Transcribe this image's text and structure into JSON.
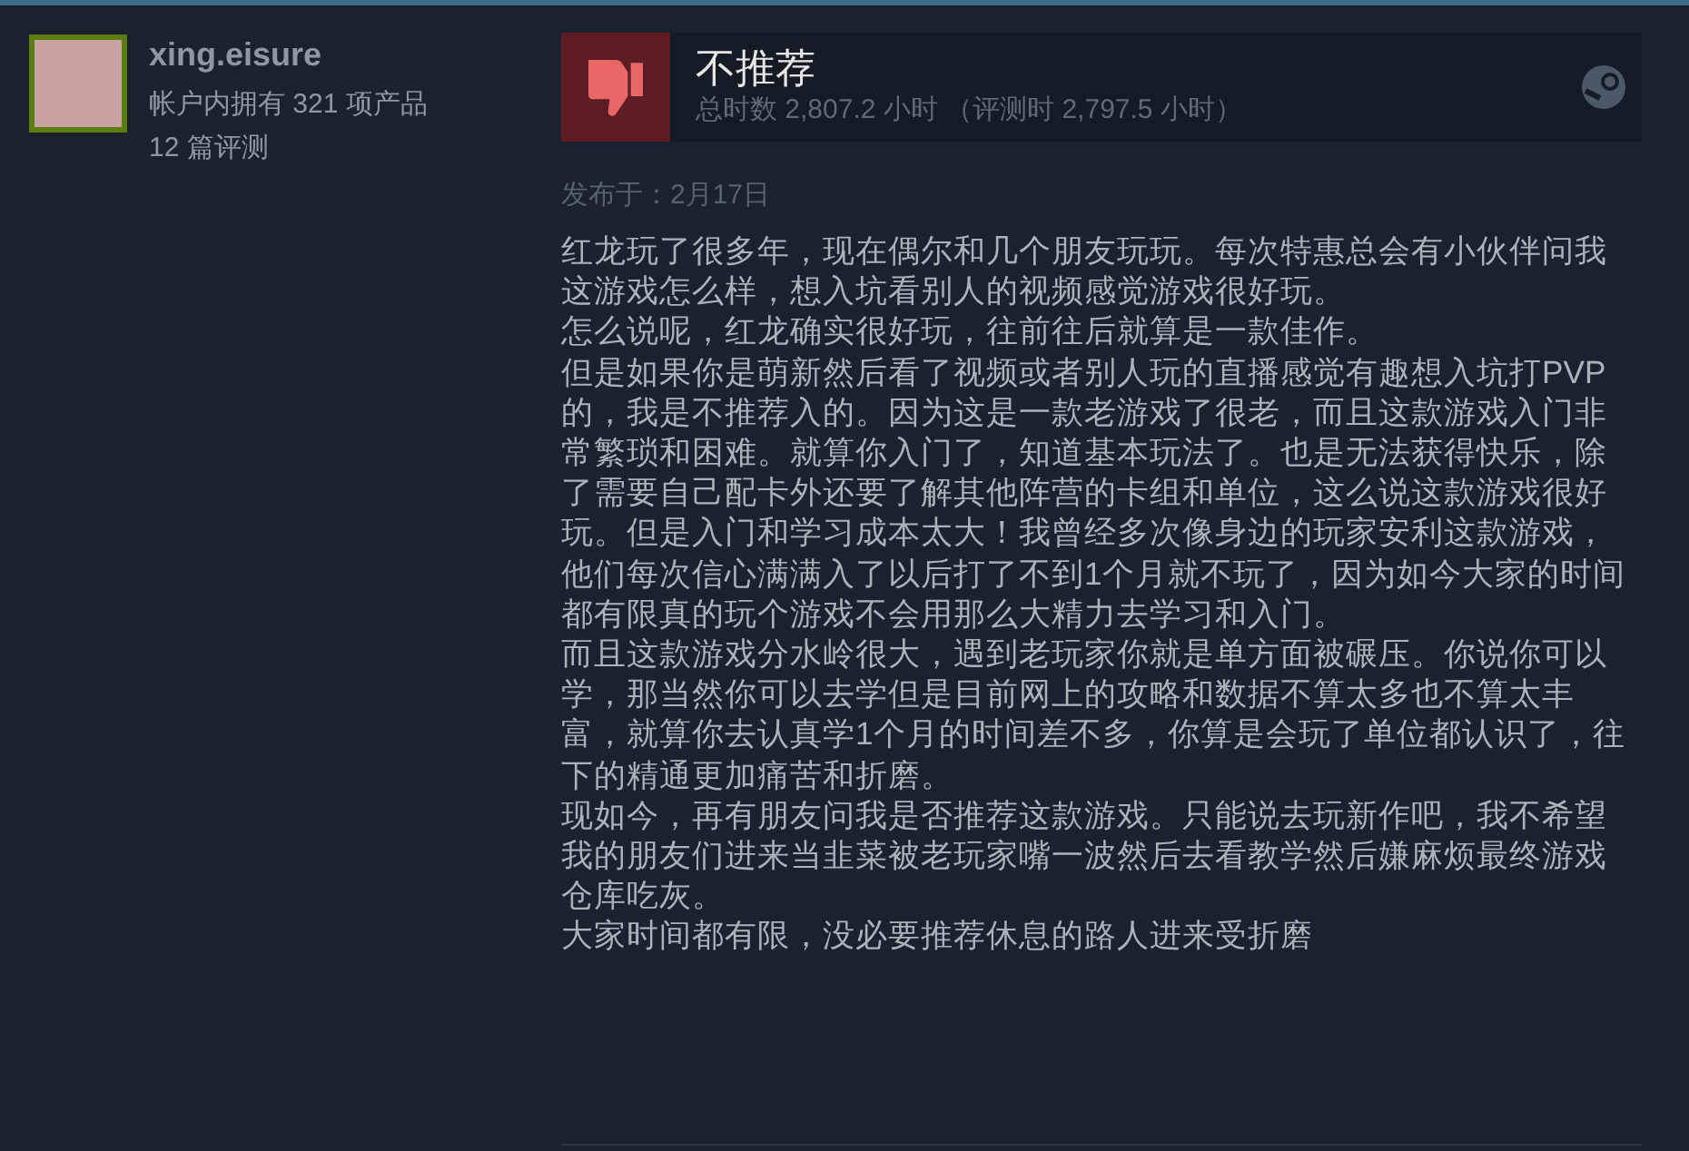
{
  "reviewer": {
    "name": "xing.eisure",
    "products": "帐户内拥有 321 项产品",
    "reviews": "12 篇评测"
  },
  "review": {
    "recommended": false,
    "verdict": "不推荐",
    "hours": "总时数 2,807.2 小时 （评测时 2,797.5 小时）",
    "posted": "发布于：2月17日",
    "paragraphs": [
      "红龙玩了很多年，现在偶尔和几个朋友玩玩。每次特惠总会有小伙伴问我这游戏怎么样，想入坑看别人的视频感觉游戏很好玩。",
      "怎么说呢，红龙确实很好玩，往前往后就算是一款佳作。",
      "但是如果你是萌新然后看了视频或者别人玩的直播感觉有趣想入坑打PVP的，我是不推荐入的。因为这是一款老游戏了很老，而且这款游戏入门非常繁琐和困难。就算你入门了，知道基本玩法了。也是无法获得快乐，除了需要自己配卡外还要了解其他阵营的卡组和单位，这么说这款游戏很好玩。但是入门和学习成本太大！我曾经多次像身边的玩家安利这款游戏，他们每次信心满满入了以后打了不到1个月就不玩了，因为如今大家的时间都有限真的玩个游戏不会用那么大精力去学习和入门。",
      "而且这款游戏分水岭很大，遇到老玩家你就是单方面被碾压。你说你可以学，那当然你可以去学但是目前网上的攻略和数据不算太多也不算太丰富，就算你去认真学1个月的时间差不多，你算是会玩了单位都认识了，往下的精通更加痛苦和折磨。",
      "现如今，再有朋友问我是否推荐这款游戏。只能说去玩新作吧，我不希望我的朋友们进来当韭菜被老玩家嘴一波然后去看教学然后嫌麻烦最终游戏仓库吃灰。",
      "大家时间都有限，没必要推荐休息的路人进来受折磨"
    ]
  }
}
